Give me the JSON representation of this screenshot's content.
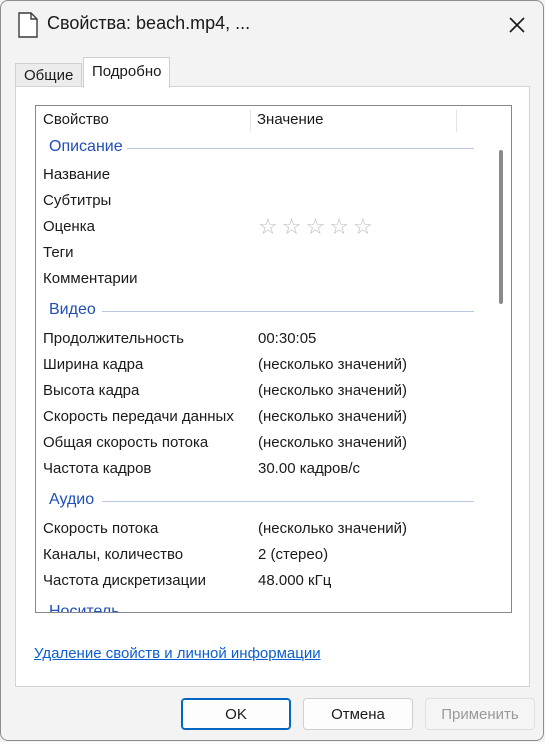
{
  "window": {
    "title": "Свойства: beach.mp4, ..."
  },
  "tabs": [
    {
      "label": "Общие"
    },
    {
      "label": "Подробно"
    }
  ],
  "columns": {
    "property": "Свойство",
    "value": "Значение"
  },
  "groups": {
    "description": {
      "label": "Описание",
      "rows": [
        {
          "property": "Название",
          "value": ""
        },
        {
          "property": "Субтитры",
          "value": ""
        },
        {
          "property": "Оценка",
          "value": "",
          "rating_stars": 0
        },
        {
          "property": "Теги",
          "value": ""
        },
        {
          "property": "Комментарии",
          "value": ""
        }
      ]
    },
    "video": {
      "label": "Видео",
      "rows": [
        {
          "property": "Продолжительность",
          "value": "00:30:05"
        },
        {
          "property": "Ширина кадра",
          "value": "(несколько значений)"
        },
        {
          "property": "Высота кадра",
          "value": "(несколько значений)"
        },
        {
          "property": "Скорость передачи данных",
          "value": "(несколько значений)"
        },
        {
          "property": "Общая скорость потока",
          "value": "(несколько значений)"
        },
        {
          "property": "Частота кадров",
          "value": "30.00 кадров/с"
        }
      ]
    },
    "audio": {
      "label": "Аудио",
      "rows": [
        {
          "property": "Скорость потока",
          "value": "(несколько значений)"
        },
        {
          "property": "Каналы, количество",
          "value": "2 (стерео)"
        },
        {
          "property": "Частота дискретизации",
          "value": "48.000 кГц"
        }
      ]
    },
    "media": {
      "label": "Носитель"
    }
  },
  "links": {
    "remove_properties": "Удаление свойств и личной информации"
  },
  "buttons": {
    "ok": "OK",
    "cancel": "Отмена",
    "apply": "Применить"
  },
  "colors": {
    "group_heading": "#1f4fb8",
    "link": "#0b5ed0",
    "accent": "#0067c0"
  }
}
